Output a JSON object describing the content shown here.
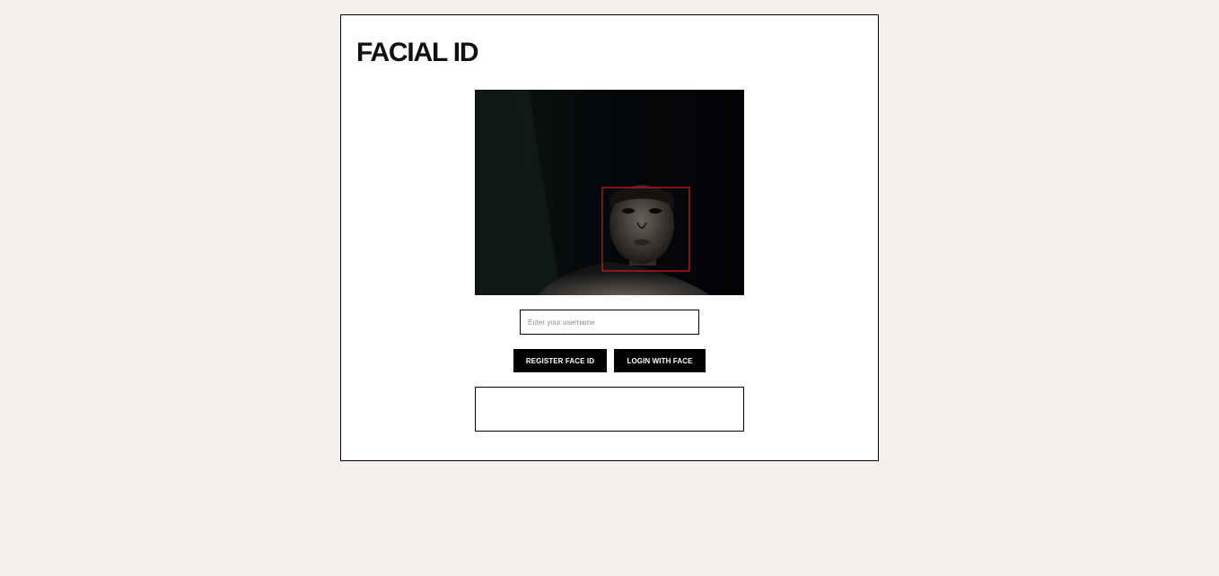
{
  "app": {
    "title": "FACIAL ID"
  },
  "camera": {
    "face_box_color": "#ff1e1e"
  },
  "form": {
    "username_placeholder": "Enter your username",
    "username_value": ""
  },
  "buttons": {
    "register_label": "REGISTER FACE ID",
    "login_label": "LOGIN WITH FACE"
  },
  "result": {
    "message": ""
  }
}
